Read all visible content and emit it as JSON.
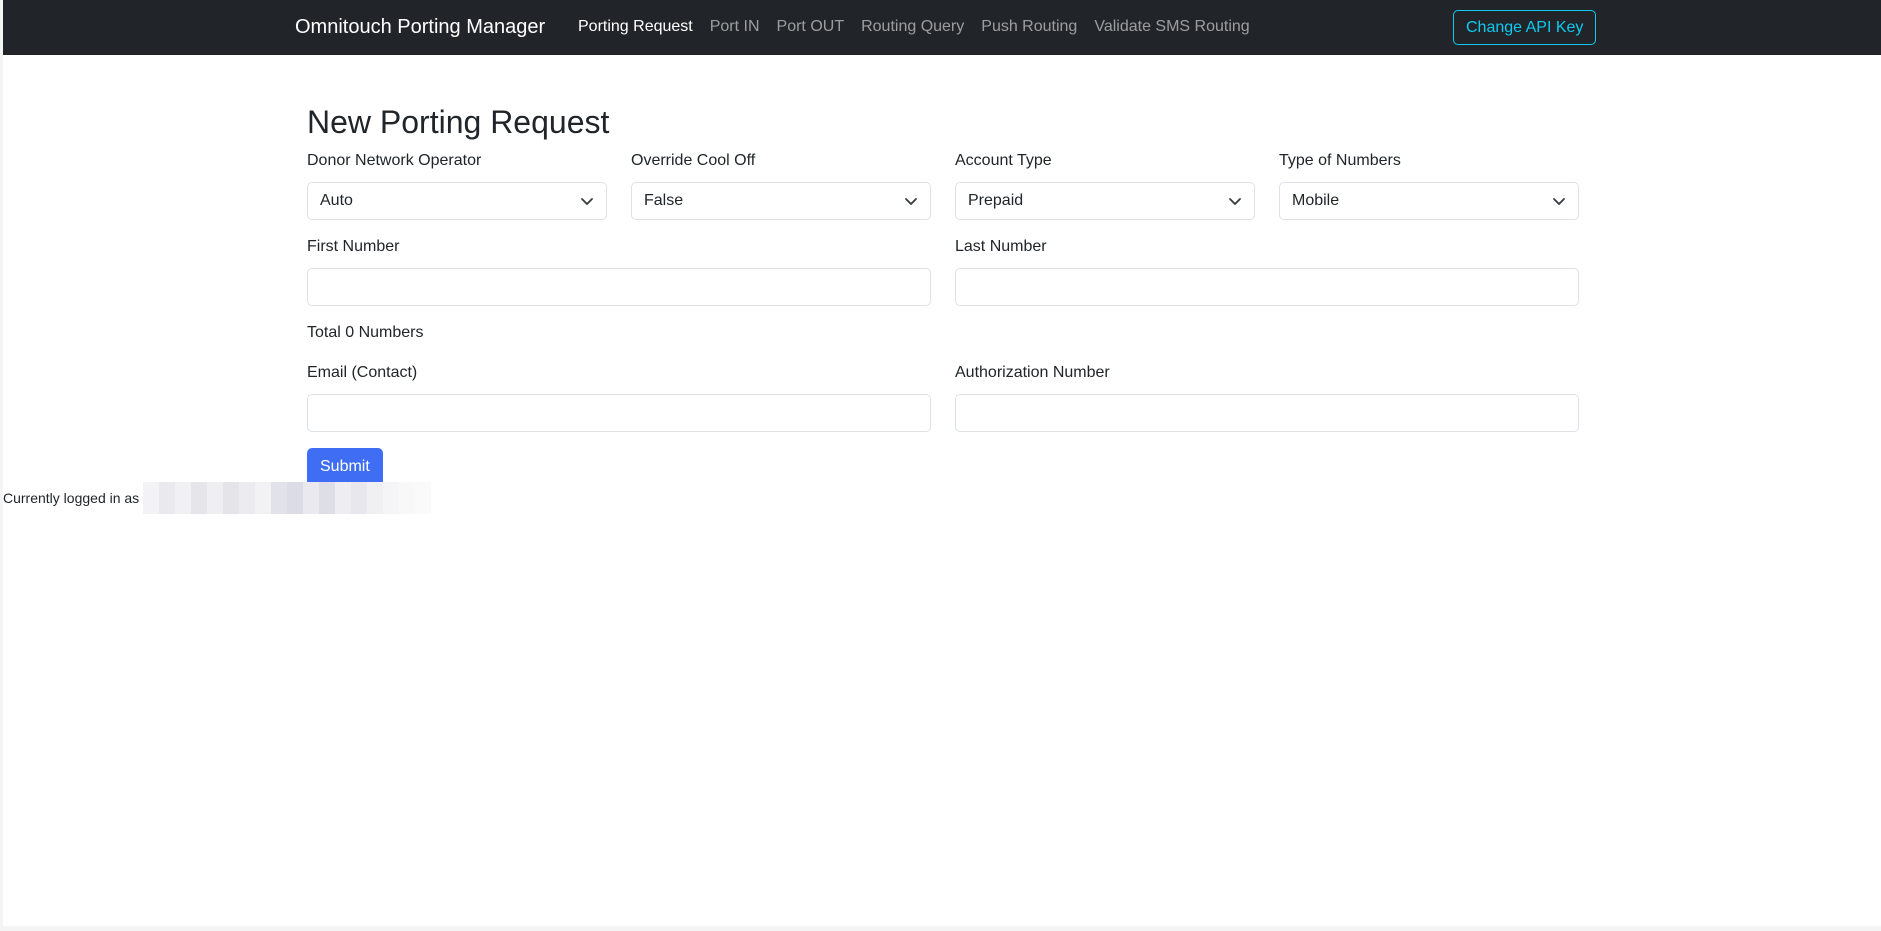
{
  "navbar": {
    "brand": "Omnitouch Porting Manager",
    "links": [
      {
        "label": "Porting Request",
        "active": true
      },
      {
        "label": "Port IN",
        "active": false
      },
      {
        "label": "Port OUT",
        "active": false
      },
      {
        "label": "Routing Query",
        "active": false
      },
      {
        "label": "Push Routing",
        "active": false
      },
      {
        "label": "Validate SMS Routing",
        "active": false
      }
    ],
    "api_button": "Change API Key"
  },
  "form": {
    "title": "New Porting Request",
    "donor_network_operator": {
      "label": "Donor Network Operator",
      "value": "Auto"
    },
    "override_cool_off": {
      "label": "Override Cool Off",
      "value": "False"
    },
    "account_type": {
      "label": "Account Type",
      "value": "Prepaid"
    },
    "type_of_numbers": {
      "label": "Type of Numbers",
      "value": "Mobile"
    },
    "first_number": {
      "label": "First Number",
      "value": ""
    },
    "last_number": {
      "label": "Last Number",
      "value": ""
    },
    "total_numbers": "Total 0 Numbers",
    "email_contact": {
      "label": "Email (Contact)",
      "value": ""
    },
    "authorization_number": {
      "label": "Authorization Number",
      "value": ""
    },
    "submit_label": "Submit"
  },
  "footer": {
    "logged_in_text": "Currently logged in as"
  },
  "colors": {
    "navbar_bg": "#212529",
    "accent_primary": "#3f6ef5",
    "accent_info": "#0dcaf0"
  },
  "icons": {
    "select_arrow": "chevron-down-icon"
  }
}
